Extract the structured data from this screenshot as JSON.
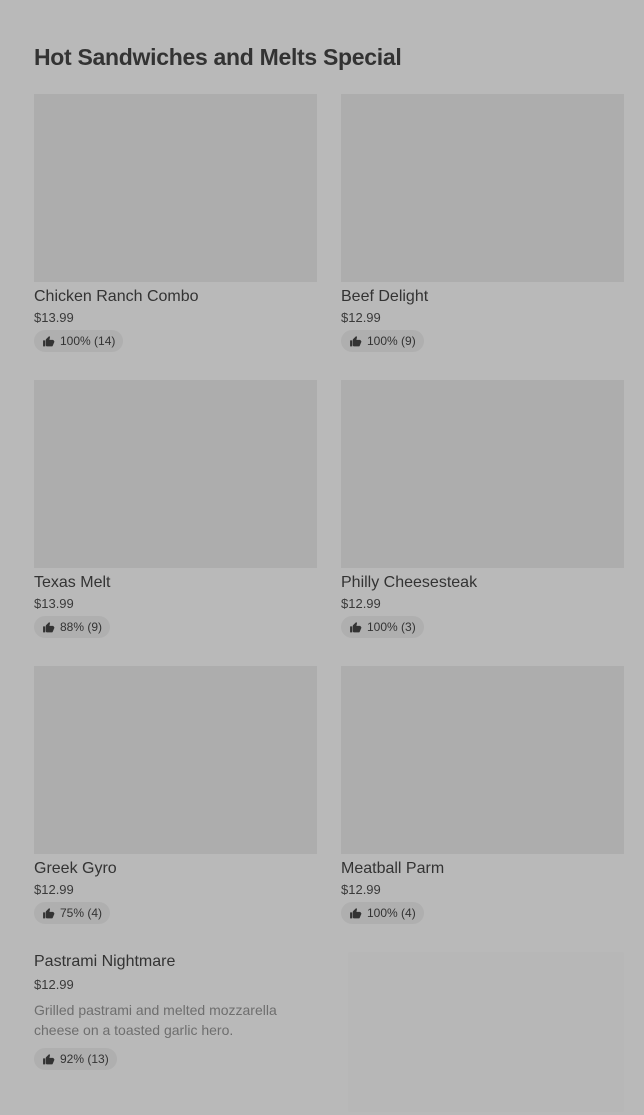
{
  "section": {
    "title": "Hot Sandwiches and Melts Special"
  },
  "items": [
    {
      "name": "Chicken Ranch Combo",
      "price": "$13.99",
      "rating": "100% (14)"
    },
    {
      "name": "Beef Delight",
      "price": "$12.99",
      "rating": "100% (9)"
    },
    {
      "name": "Texas Melt",
      "price": "$13.99",
      "rating": "88% (9)"
    },
    {
      "name": "Philly Cheesesteak",
      "price": "$12.99",
      "rating": "100% (3)"
    },
    {
      "name": "Greek Gyro",
      "price": "$12.99",
      "rating": "75% (4)"
    },
    {
      "name": "Meatball Parm",
      "price": "$12.99",
      "rating": "100% (4)"
    }
  ],
  "featured": {
    "name": "Pastrami Nightmare",
    "price": "$12.99",
    "description": "Grilled pastrami and melted mozzarella cheese on a toasted garlic hero.",
    "rating": "92% (13)"
  },
  "icons": {
    "rating": "thumbs-up-icon"
  },
  "colors": {
    "background": "#b9b9b9",
    "image_placeholder": "#adadad",
    "rating_pill": "#afafaf",
    "text": "#333333",
    "description_text": "#6e6e6e"
  }
}
